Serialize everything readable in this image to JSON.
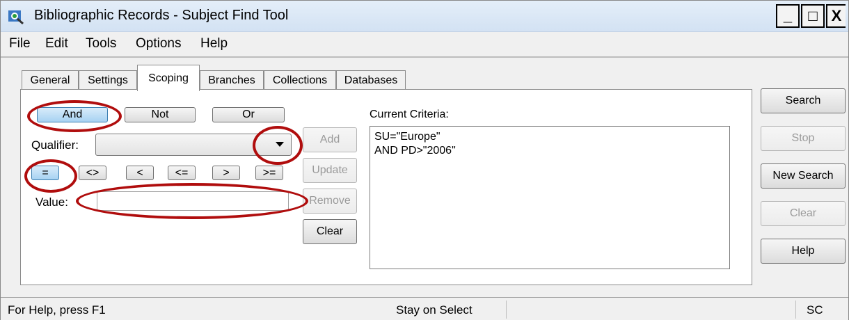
{
  "window": {
    "title": "Bibliographic Records - Subject Find Tool",
    "min_glyph": "_",
    "max_glyph": "□",
    "close_glyph": "X"
  },
  "menu": [
    "File",
    "Edit",
    "Tools",
    "Options",
    "Help"
  ],
  "tabs": [
    {
      "label": "General",
      "active": false
    },
    {
      "label": "Settings",
      "active": false
    },
    {
      "label": "Scoping",
      "active": true
    },
    {
      "label": "Branches",
      "active": false
    },
    {
      "label": "Collections",
      "active": false
    },
    {
      "label": "Databases",
      "active": false
    }
  ],
  "scoping": {
    "logic_buttons": [
      {
        "label": "And",
        "pressed": true
      },
      {
        "label": "Not",
        "pressed": false
      },
      {
        "label": "Or",
        "pressed": false
      }
    ],
    "qualifier_label": "Qualifier:",
    "qualifier_value": "",
    "operators": [
      {
        "label": "=",
        "pressed": true
      },
      {
        "label": "<>",
        "pressed": false
      },
      {
        "label": "<",
        "pressed": false
      },
      {
        "label": "<=",
        "pressed": false
      },
      {
        "label": ">",
        "pressed": false
      },
      {
        "label": ">=",
        "pressed": false
      }
    ],
    "value_label": "Value:",
    "value": "",
    "add_label": "Add",
    "update_label": "Update",
    "remove_label": "Remove",
    "clear_label": "Clear",
    "criteria_label": "Current Criteria:",
    "criteria_lines": [
      "SU=\"Europe\"",
      "AND PD>\"2006\""
    ]
  },
  "side_buttons": {
    "search": "Search",
    "stop": "Stop",
    "new_search": "New Search",
    "clear": "Clear",
    "help": "Help"
  },
  "status_bar": {
    "help": "For Help, press F1",
    "mode": "Stay on Select",
    "indicator": "SC"
  },
  "colors": {
    "callout": "#b00d0d",
    "pressed_button": "#a7d2f2"
  }
}
